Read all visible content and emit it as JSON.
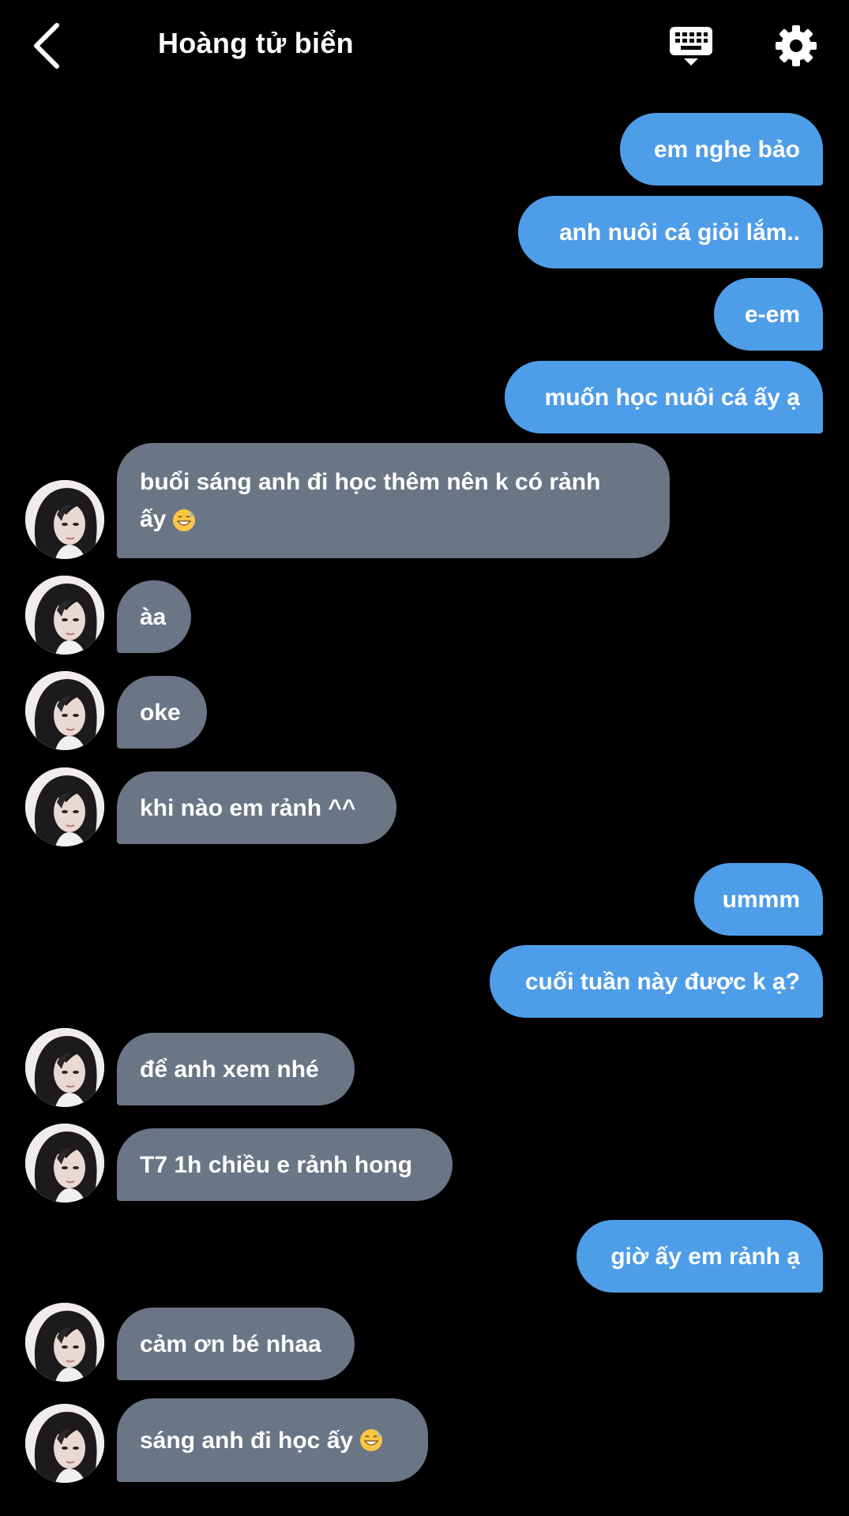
{
  "header": {
    "title": "Hoàng tử biển"
  },
  "messages": [
    {
      "text": "em nghe bảo",
      "side": "out"
    },
    {
      "text": "anh nuôi cá giỏi lắm..",
      "side": "out"
    },
    {
      "text": "e-em",
      "side": "out"
    },
    {
      "text": "muốn học nuôi cá ấy ạ",
      "side": "out"
    },
    {
      "text": "buổi sáng anh đi học thêm nên k có rảnh ấy",
      "side": "in",
      "emoji": "grinning-sweat-emoji"
    },
    {
      "text": "àa",
      "side": "in"
    },
    {
      "text": "oke",
      "side": "in"
    },
    {
      "text": "khi nào em rảnh ^^",
      "side": "in"
    },
    {
      "text": "ummm",
      "side": "out"
    },
    {
      "text": "cuối tuần này được k ạ?",
      "side": "out"
    },
    {
      "text": "để anh xem nhé",
      "side": "in"
    },
    {
      "text": "T7 1h chiều e rảnh hong",
      "side": "in"
    },
    {
      "text": "giờ ấy em rảnh ạ",
      "side": "out"
    },
    {
      "text": "cảm ơn bé nhaa",
      "side": "in"
    },
    {
      "text": "sáng anh đi học ấy",
      "side": "in",
      "emoji": "grinning-sweat-emoji"
    }
  ],
  "colors": {
    "background": "#000000",
    "outgoing_bubble": "#4e9de8",
    "incoming_bubble": "#6a7585",
    "text": "#ffffff"
  },
  "icons": {
    "back": "chevron-left-icon",
    "keyboard": "keyboard-icon",
    "settings": "gear-icon",
    "avatar": "contact-avatar"
  }
}
